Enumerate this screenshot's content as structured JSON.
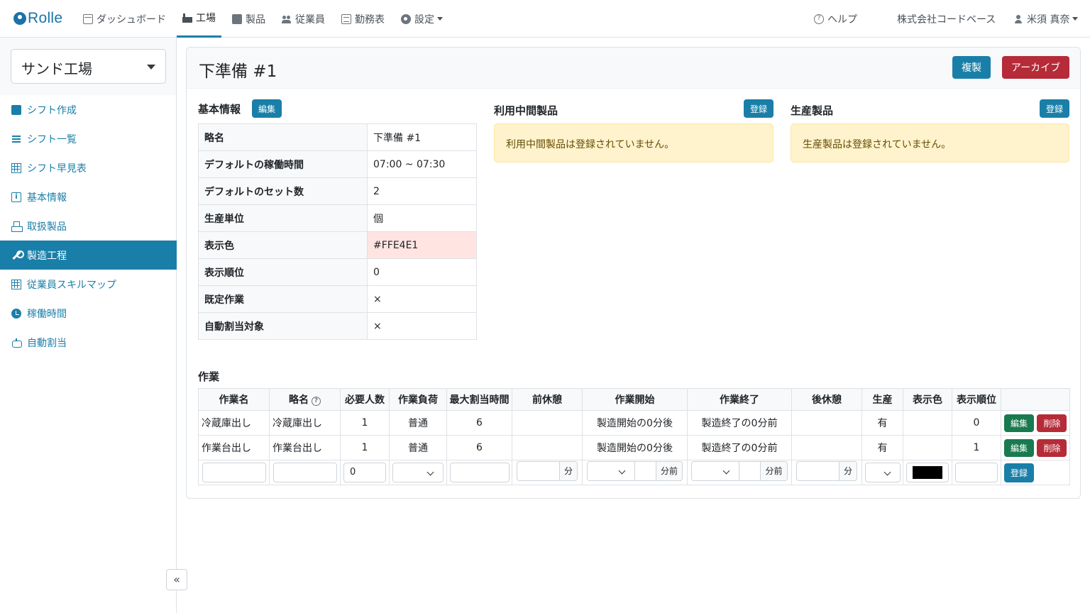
{
  "brand": {
    "name": "Rolle",
    "color": "#1a73a8"
  },
  "nav": {
    "items": [
      {
        "label": "ダッシュボード",
        "icon": "calendar-icon"
      },
      {
        "label": "工場",
        "icon": "factory-icon",
        "active": true
      },
      {
        "label": "製品",
        "icon": "box-icon"
      },
      {
        "label": "従業員",
        "icon": "users-icon"
      },
      {
        "label": "勤務表",
        "icon": "sheet-icon"
      },
      {
        "label": "設定",
        "icon": "gear-icon"
      }
    ],
    "help": "ヘルプ",
    "company": "株式会社コードベース",
    "user": "米須 真奈"
  },
  "sidebar": {
    "factory": "サンド工場",
    "items": [
      {
        "label": "シフト作成",
        "icon": "calendar-plus-icon"
      },
      {
        "label": "シフト一覧",
        "icon": "list-icon"
      },
      {
        "label": "シフト早見表",
        "icon": "table-icon"
      },
      {
        "label": "基本情報",
        "icon": "info-icon"
      },
      {
        "label": "取扱製品",
        "icon": "boxes-icon"
      },
      {
        "label": "製造工程",
        "icon": "wrench-icon",
        "active": true
      },
      {
        "label": "従業員スキルマップ",
        "icon": "grid-icon"
      },
      {
        "label": "稼働時間",
        "icon": "clock-icon"
      },
      {
        "label": "自動割当",
        "icon": "robot-icon"
      }
    ],
    "collapse": "«"
  },
  "page": {
    "title": "下準備 #1",
    "copy_button": "複製",
    "archive_button": "アーカイブ"
  },
  "basic": {
    "title": "基本情報",
    "edit_button": "編集",
    "rows": [
      {
        "key": "略名",
        "value": "下準備 #1"
      },
      {
        "key": "デフォルトの稼働時間",
        "value": "07:00 ~ 07:30"
      },
      {
        "key": "デフォルトのセット数",
        "value": "2"
      },
      {
        "key": "生産単位",
        "value": "個"
      },
      {
        "key": "表示色",
        "value": "#FFE4E1"
      },
      {
        "key": "表示順位",
        "value": "0"
      },
      {
        "key": "既定作業",
        "value": "×"
      },
      {
        "key": "自動割当対象",
        "value": "×"
      }
    ]
  },
  "intermediate": {
    "title": "利用中間製品",
    "register_button": "登録",
    "empty": "利用中間製品は登録されていません。"
  },
  "produced": {
    "title": "生産製品",
    "register_button": "登録",
    "empty": "生産製品は登録されていません。"
  },
  "tasks": {
    "title": "作業",
    "headers": [
      "作業名",
      "略名",
      "必要人数",
      "作業負荷",
      "最大割当時間",
      "前休憩",
      "作業開始",
      "作業終了",
      "後休憩",
      "生産",
      "表示色",
      "表示順位",
      ""
    ],
    "rows": [
      {
        "name": "冷蔵庫出し",
        "short": "冷蔵庫出し",
        "people": "1",
        "load": "普通",
        "max": "6",
        "pre": "",
        "start": "製造開始の0分後",
        "end": "製造終了の0分前",
        "post": "",
        "produce": "有",
        "color": "",
        "order": "0"
      },
      {
        "name": "作業台出し",
        "short": "作業台出し",
        "people": "1",
        "load": "普通",
        "max": "6",
        "pre": "",
        "start": "製造開始の0分後",
        "end": "製造終了の0分前",
        "post": "",
        "produce": "有",
        "color": "",
        "order": "1"
      }
    ],
    "edit_button": "編集",
    "delete_button": "削除",
    "form": {
      "people_value": "0",
      "minute_unit": "分",
      "minute_before_unit": "分前",
      "register_button": "登録"
    }
  }
}
